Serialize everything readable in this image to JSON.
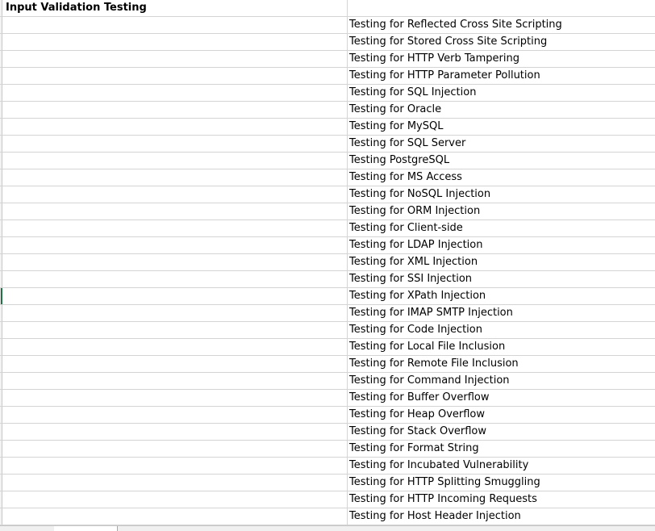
{
  "sheet": {
    "section_title": "Input Validation Testing",
    "items": [
      "Testing for Reflected Cross Site Scripting",
      "Testing for Stored Cross Site Scripting",
      "Testing for HTTP Verb Tampering",
      "Testing for HTTP Parameter Pollution",
      "Testing for SQL Injection",
      "Testing for Oracle",
      "Testing for MySQL",
      "Testing for SQL Server",
      "Testing PostgreSQL",
      "Testing for MS Access",
      "Testing for NoSQL Injection",
      "Testing for ORM Injection",
      "Testing for Client-side",
      "Testing for LDAP Injection",
      "Testing for XML Injection",
      "Testing for SSI Injection",
      "Testing for XPath Injection",
      "Testing for IMAP SMTP Injection",
      "Testing for Code Injection",
      "Testing for Local File Inclusion",
      "Testing for Remote File Inclusion",
      "Testing for Command Injection",
      "Testing for Buffer Overflow",
      "Testing for Heap Overflow",
      "Testing for Stack Overflow",
      "Testing for Format String",
      "Testing for Incubated Vulnerability",
      "Testing for HTTP Splitting Smuggling",
      "Testing for HTTP Incoming Requests",
      "Testing for Host Header Injection"
    ]
  },
  "colors": {
    "selection_accent": "#217346",
    "gridline": "#d4d4d4",
    "header_bg": "#f3f3f3"
  }
}
